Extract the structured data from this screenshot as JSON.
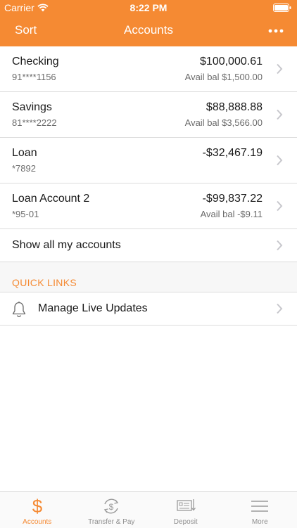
{
  "status_bar": {
    "carrier": "Carrier",
    "time": "8:22 PM"
  },
  "nav": {
    "left_label": "Sort",
    "title": "Accounts",
    "more_icon": "ellipsis-icon"
  },
  "accounts": [
    {
      "name": "Checking",
      "number": "91****1156",
      "balance": "$100,000.61",
      "avail": "Avail bal $1,500.00"
    },
    {
      "name": "Savings",
      "number": "81****2222",
      "balance": "$88,888.88",
      "avail": "Avail bal $3,566.00"
    },
    {
      "name": "Loan",
      "number": "*7892",
      "balance": "-$32,467.19",
      "avail": ""
    },
    {
      "name": "Loan Account 2",
      "number": "*95-01",
      "balance": "-$99,837.22",
      "avail": "Avail bal -$9.11"
    }
  ],
  "show_all_label": "Show all my accounts",
  "quick_links": {
    "header": "QUICK LINKS",
    "items": [
      {
        "label": "Manage Live Updates",
        "icon": "bell-icon"
      }
    ]
  },
  "tabs": [
    {
      "label": "Accounts",
      "icon": "dollar-icon",
      "active": true
    },
    {
      "label": "Transfer & Pay",
      "icon": "transfer-icon",
      "active": false
    },
    {
      "label": "Deposit",
      "icon": "check-deposit-icon",
      "active": false
    },
    {
      "label": "More",
      "icon": "menu-icon",
      "active": false
    }
  ],
  "colors": {
    "accent": "#f58a33",
    "secondary_text": "#6b6b6b",
    "separator": "#dcdcdc"
  }
}
